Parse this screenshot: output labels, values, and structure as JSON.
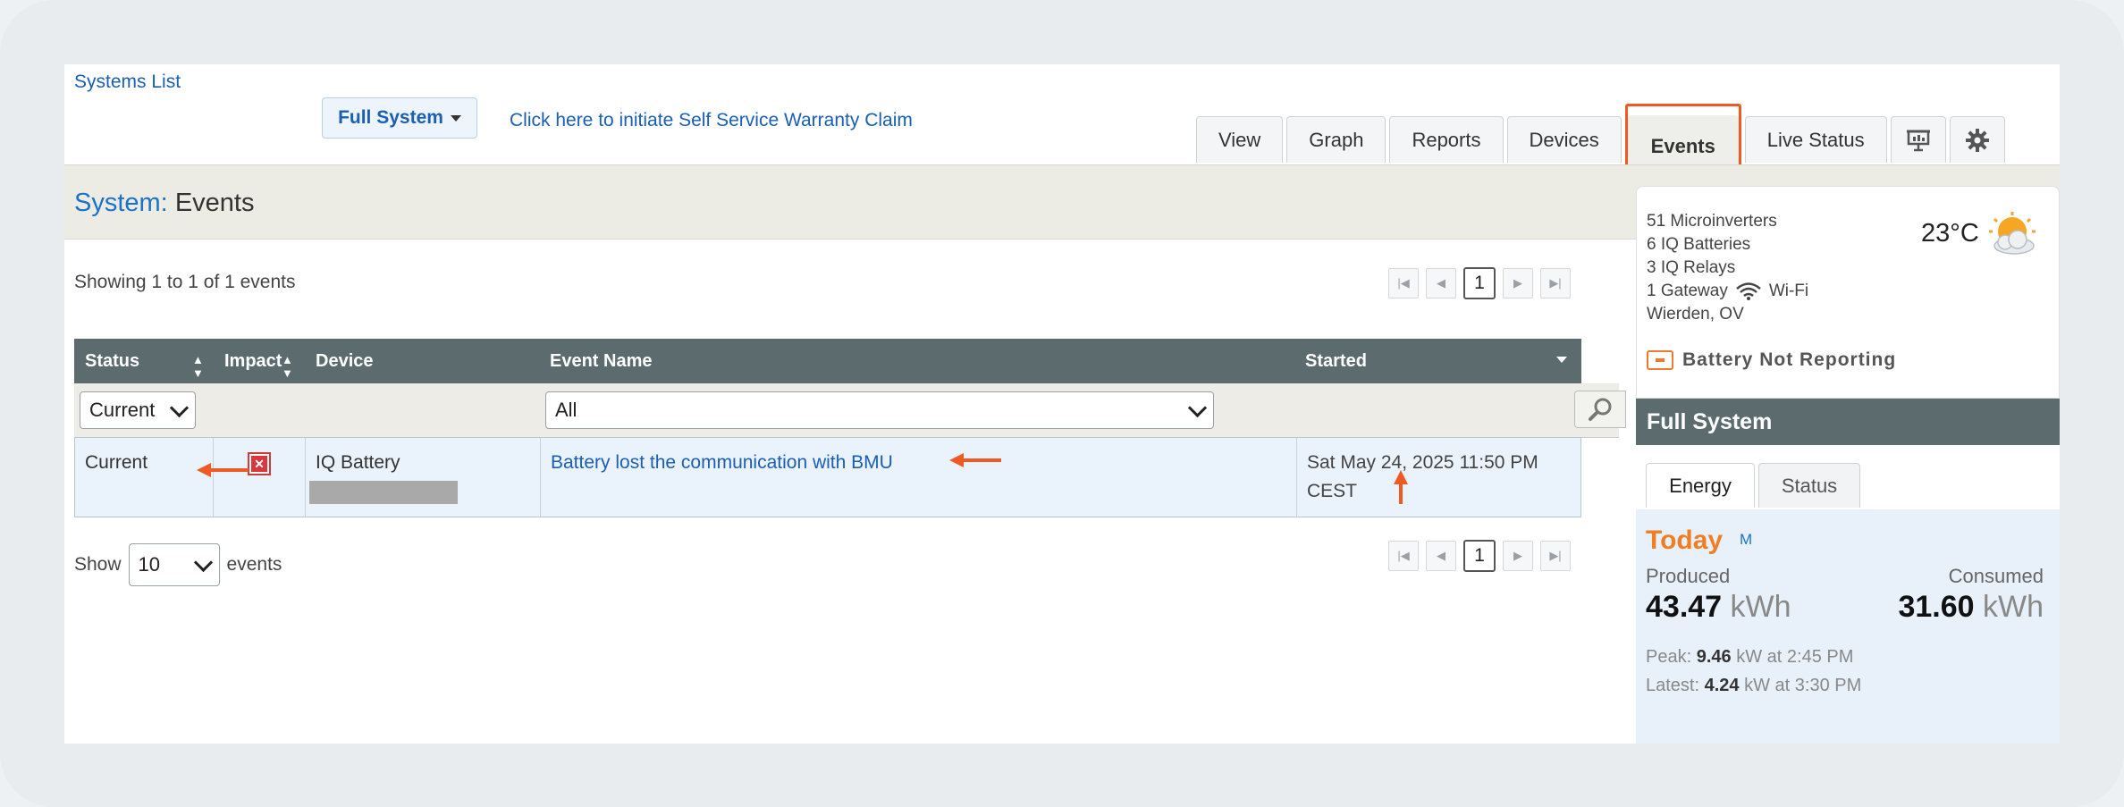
{
  "breadcrumb": {
    "systems_list": "Systems List"
  },
  "header": {
    "system_dropdown": "Full System",
    "warranty_link": "Click here to initiate Self Service Warranty Claim"
  },
  "tabs": [
    {
      "label": "View"
    },
    {
      "label": "Graph"
    },
    {
      "label": "Reports"
    },
    {
      "label": "Devices"
    },
    {
      "label": "Events",
      "active": true
    },
    {
      "label": "Live Status"
    }
  ],
  "page": {
    "title_prefix": "System:",
    "title": "Events"
  },
  "list": {
    "showing": "Showing 1 to 1 of 1 events",
    "page_number": "1",
    "columns": {
      "status": "Status",
      "impact": "Impact",
      "device": "Device",
      "event_name": "Event Name",
      "started": "Started"
    },
    "filters": {
      "status": "Current",
      "event_name": "All"
    },
    "rows": [
      {
        "status": "Current",
        "device": "IQ Battery",
        "event_name": "Battery lost the communication with BMU",
        "started_line1": "Sat May 24, 2025 11:50 PM",
        "started_line2": "CEST"
      }
    ],
    "show_label": "Show",
    "page_size": "10",
    "events_label": "events"
  },
  "summary": {
    "microinverters": "51 Microinverters",
    "batteries": "6 IQ Batteries",
    "relays": "3 IQ Relays",
    "gateway": "1 Gateway",
    "wifi": "Wi-Fi",
    "location": "Wierden, OV",
    "temperature": "23°C",
    "warning": "Battery Not Reporting",
    "weather_icon": "partly-cloudy-icon"
  },
  "energy_panel": {
    "title": "Full System",
    "tabs": [
      "Energy",
      "Status"
    ],
    "today": "Today",
    "m_link": "M",
    "produced_label": "Produced",
    "consumed_label": "Consumed",
    "produced_value": "43.47",
    "consumed_value": "31.60",
    "unit": "kWh",
    "peak_label": "Peak:",
    "peak_value": "9.46",
    "peak_rest": "kW at 2:45 PM",
    "latest_label": "Latest:",
    "latest_value": "4.24",
    "latest_rest": "kW at 3:30 PM"
  },
  "colors": {
    "accent": "#ee5a21",
    "link": "#1a5fb4",
    "header_bar": "#5c6b6d",
    "today": "#f07e26"
  }
}
